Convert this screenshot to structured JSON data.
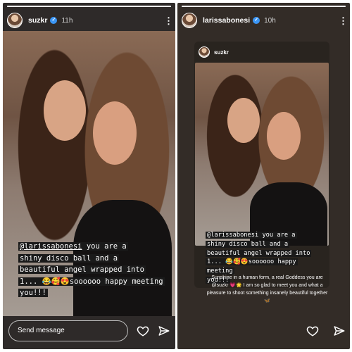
{
  "left_story": {
    "username": "suzkr",
    "time": "11h",
    "progress": 1.0,
    "caption_lines": [
      "@larissabonesi you are a",
      "shiny disco ball and a",
      "beautiful angel wrapped into",
      "1... 😂🥰😍soooooo happy meeting",
      "you!!!"
    ],
    "mention": "@larissabonesi",
    "message_placeholder": "Send message",
    "icons": {
      "more": "more-vertical-icon",
      "like": "heart-icon",
      "share": "send-icon"
    }
  },
  "right_story": {
    "username": "larissabonesi",
    "time": "10h",
    "progress": 1.0,
    "reposted_username": "suzkr",
    "caption_lines": [
      "@larissabonesi you are a",
      "shiny disco ball and a",
      "beautiful angel wrapped into",
      "1... 😂🥰😍soooooo happy meeting",
      "you!!!"
    ],
    "reply_text": "Sunshine in a human form, a real Goddess you are @suzkr 💗🌟 I am so glad to meet you and what a pleasure to shoot something insanely beautiful together 🦋",
    "icons": {
      "more": "more-vertical-icon",
      "like": "heart-icon",
      "share": "send-icon"
    }
  },
  "colors": {
    "background": "#2e2a29",
    "verified": "#3b96f5",
    "caption_bg": "#1a1a1a"
  }
}
